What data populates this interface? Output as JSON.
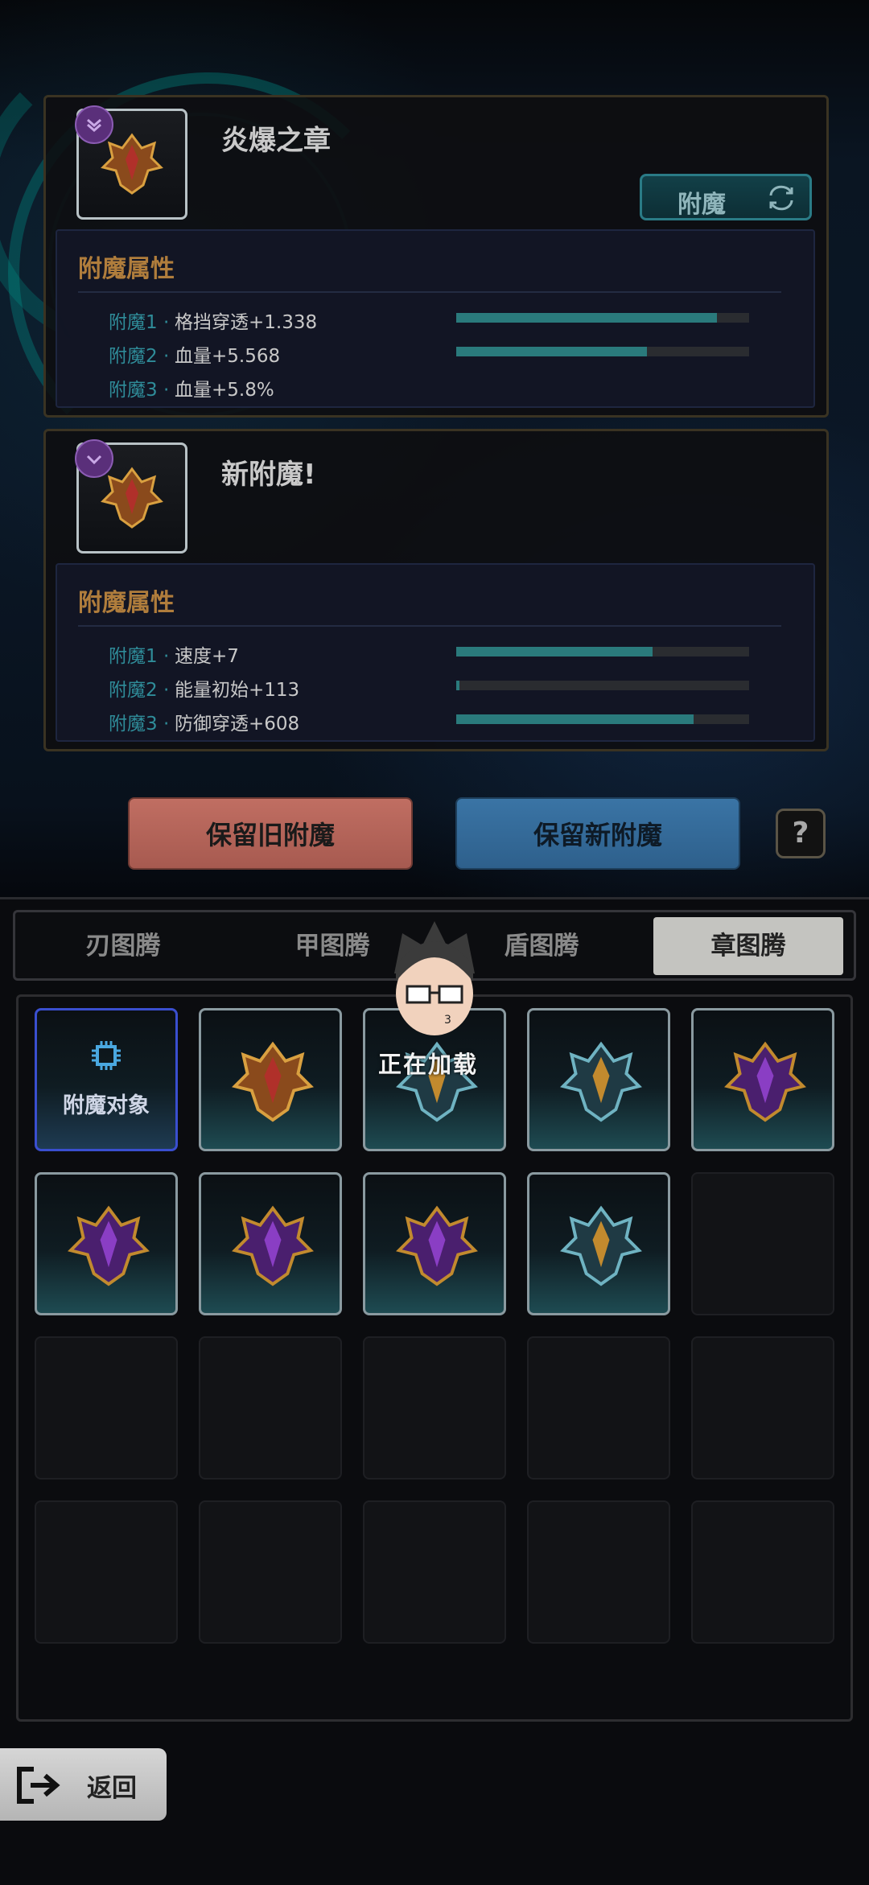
{
  "old_card": {
    "title": "炎爆之章",
    "enchant_button": "附魔",
    "attr_title": "附魔属性",
    "attrs": [
      {
        "name": "附魔1",
        "sep": "·",
        "value": "格挡穿透+1.338",
        "level": 0.89
      },
      {
        "name": "附魔2",
        "sep": "·",
        "value": "血量+5.568",
        "level": 0.65
      },
      {
        "name": "附魔3",
        "sep": "·",
        "value": "血量+5.8%",
        "level": 0.0
      }
    ]
  },
  "new_card": {
    "title": "新附魔!",
    "attr_title": "附魔属性",
    "attrs": [
      {
        "name": "附魔1",
        "sep": "·",
        "value": "速度+7",
        "level": 0.67
      },
      {
        "name": "附魔2",
        "sep": "·",
        "value": "能量初始+113",
        "level": 0.01
      },
      {
        "name": "附魔3",
        "sep": "·",
        "value": "防御穿透+608",
        "level": 0.81
      }
    ]
  },
  "actions": {
    "keep_old": "保留旧附魔",
    "keep_new": "保留新附魔",
    "help": "?"
  },
  "tabs": [
    {
      "label": "刃图腾",
      "active": false
    },
    {
      "label": "甲图腾",
      "active": false
    },
    {
      "label": "盾图腾",
      "active": false
    },
    {
      "label": "章图腾",
      "active": true
    }
  ],
  "grid": {
    "target_label": "附魔对象",
    "slots": [
      "target",
      "gold-red",
      "cyan",
      "cyan",
      "purple",
      "purple",
      "purple",
      "purple",
      "cyan",
      "empty",
      "empty",
      "empty",
      "empty",
      "empty",
      "empty",
      "empty",
      "empty",
      "empty",
      "empty",
      "empty"
    ]
  },
  "loading": {
    "text": "正在加载"
  },
  "back": {
    "label": "返回"
  },
  "colors": {
    "accent_teal": "#2a7a7c",
    "attr_title": "#b07d3c",
    "keep_old": "#b8645a",
    "keep_new": "#3470a0",
    "grade_purple": "#5a2f7a"
  }
}
